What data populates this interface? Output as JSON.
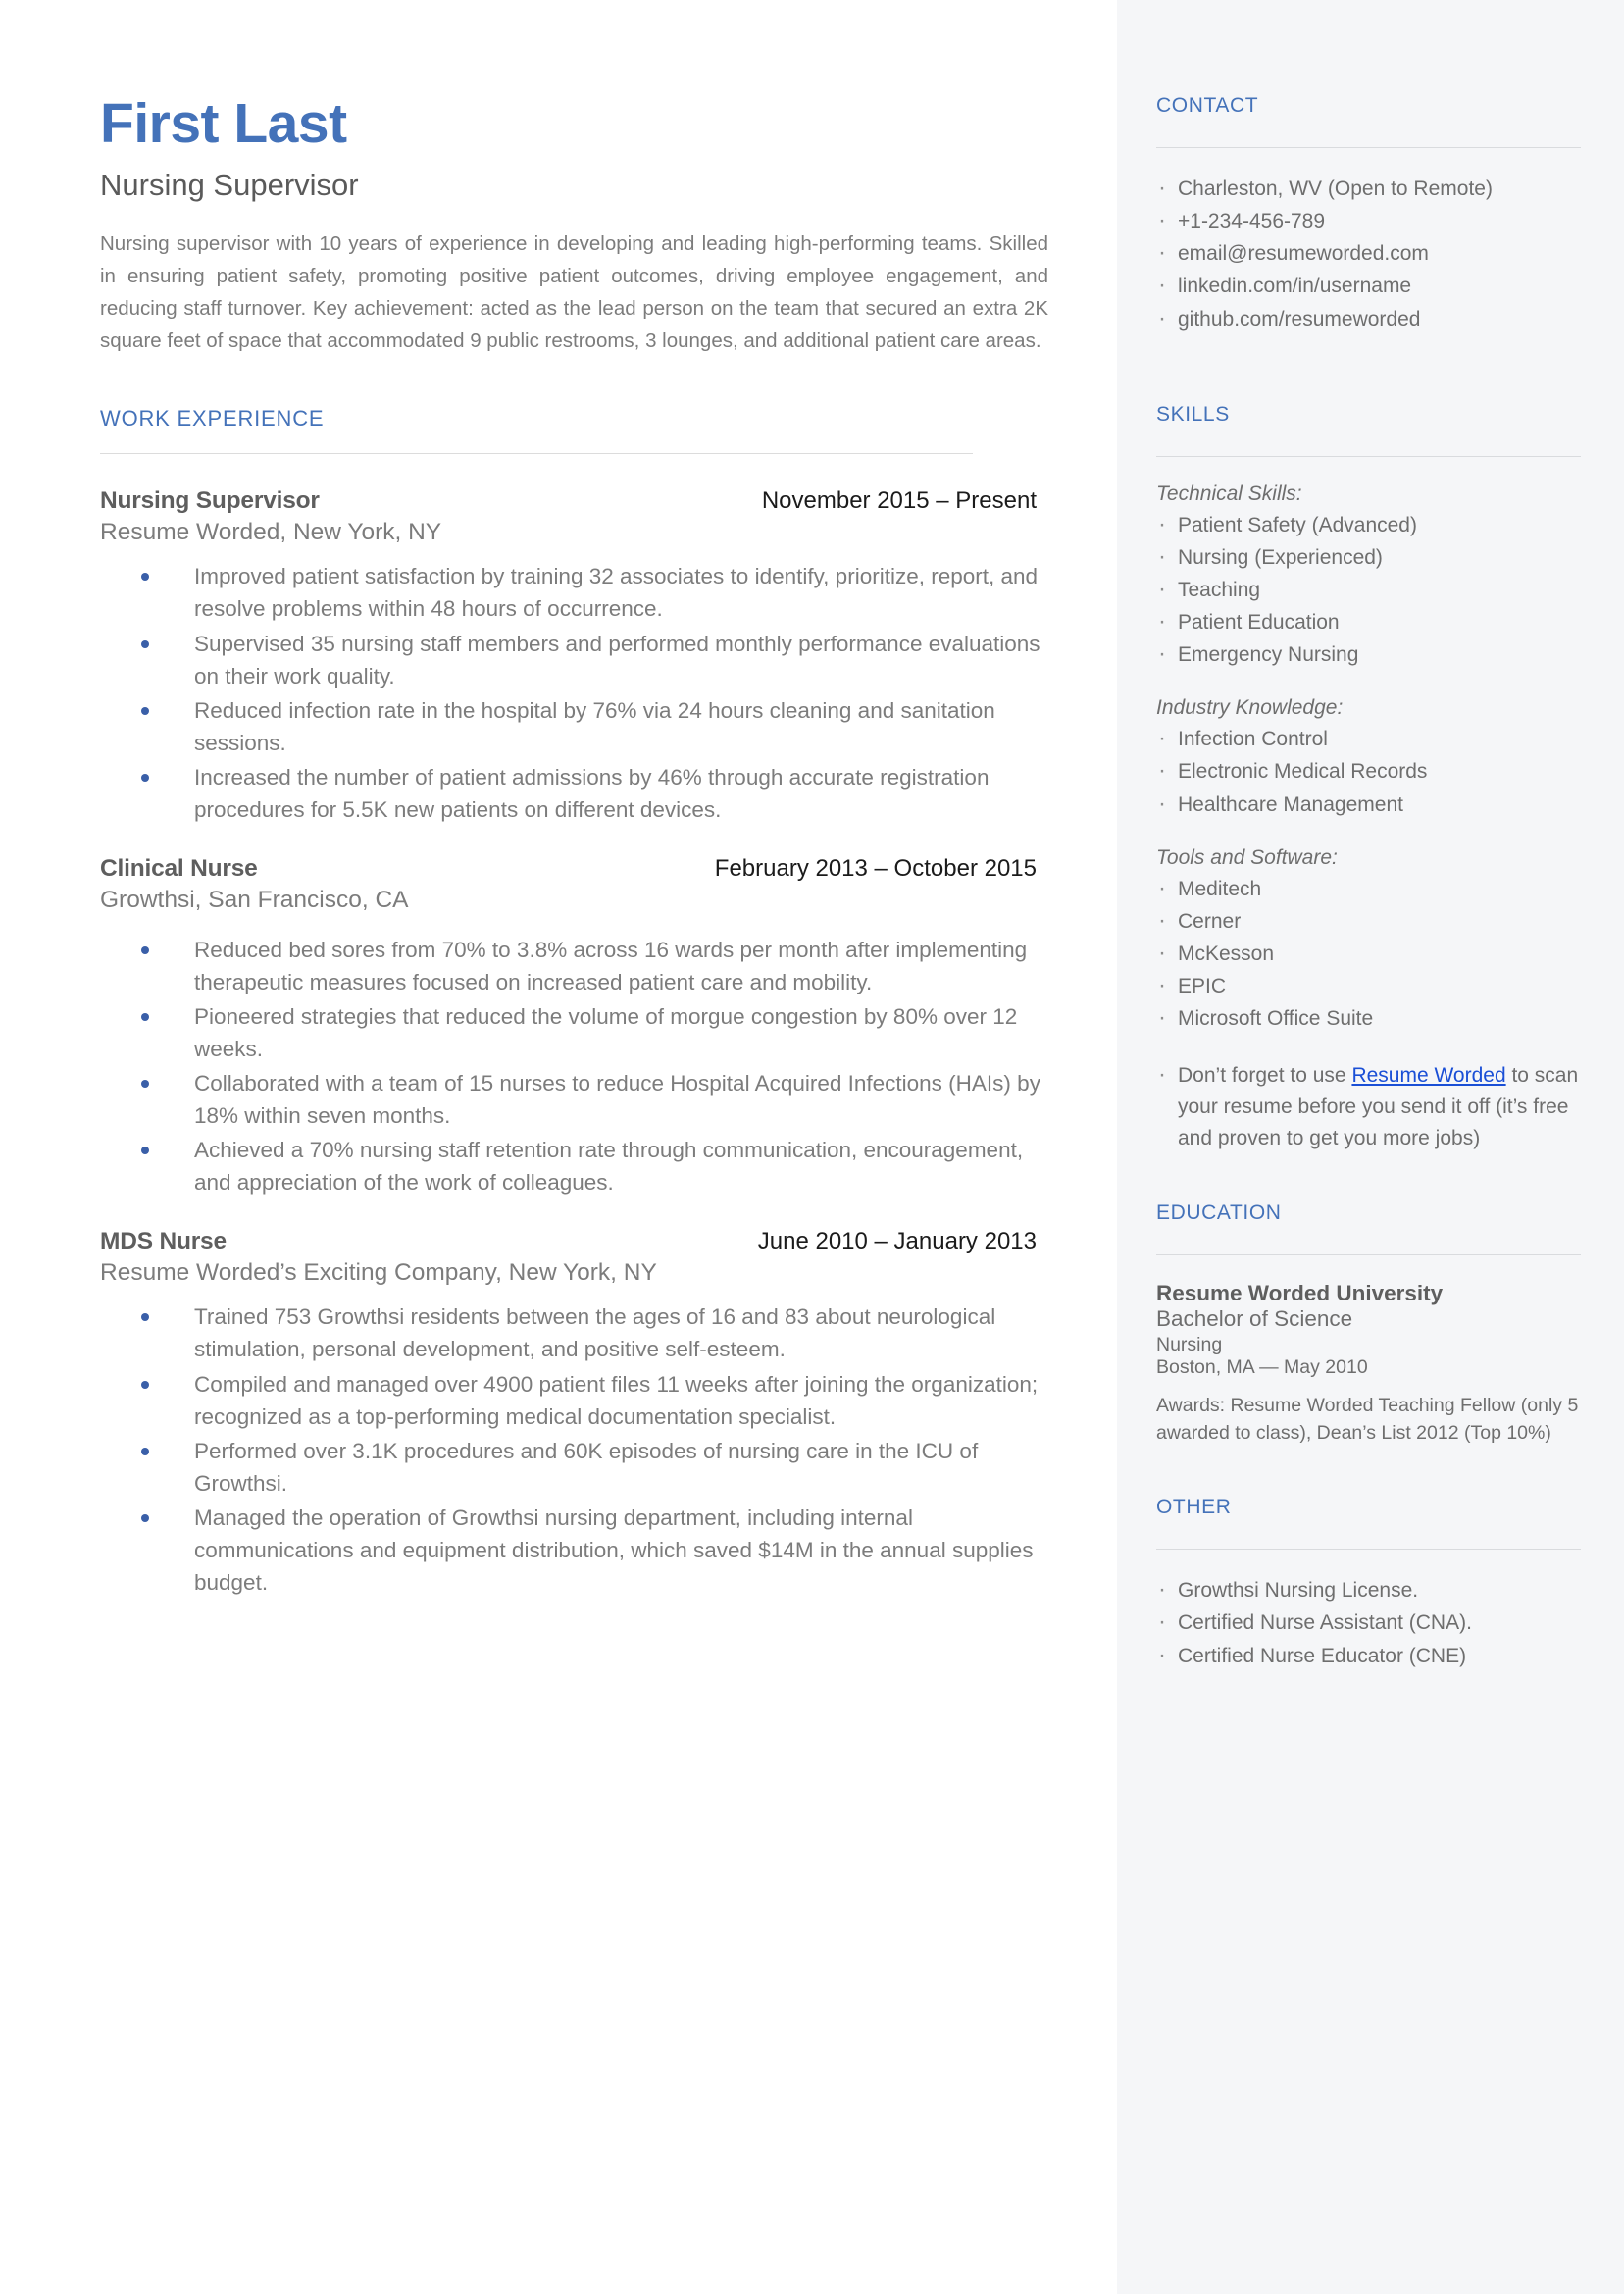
{
  "header": {
    "name": "First Last",
    "job_title": "Nursing Supervisor",
    "summary": "Nursing supervisor with 10 years of experience in developing and leading high-performing teams. Skilled in ensuring patient safety, promoting positive patient outcomes, driving employee engagement, and reducing staff turnover. Key achievement: acted as the lead person on the team that secured an extra 2K square feet of space that accommodated 9 public restrooms, 3 lounges, and additional patient care areas."
  },
  "work_experience": {
    "section_label": "WORK EXPERIENCE",
    "jobs": [
      {
        "role": "Nursing Supervisor",
        "dates": "November 2015 – Present",
        "company": "Resume Worded, New York, NY",
        "bullets": [
          "Improved patient satisfaction by training 32 associates to identify, prioritize, report, and resolve problems within 48 hours of occurrence.",
          "Supervised 35 nursing staff members and performed monthly performance evaluations on their work quality.",
          "Reduced infection rate in the hospital by 76% via 24 hours cleaning and sanitation sessions.",
          "Increased the number of patient admissions by 46% through accurate registration procedures for 5.5K new patients on different devices."
        ]
      },
      {
        "role": "Clinical Nurse",
        "dates": "February 2013 – October 2015",
        "company": "Growthsi, San Francisco, CA",
        "bullets": [
          "Reduced bed sores from 70% to 3.8% across 16 wards per month after implementing therapeutic measures focused on increased patient care and mobility.",
          "Pioneered strategies that reduced the volume of morgue congestion by 80% over 12 weeks.",
          "Collaborated with a team of 15 nurses to reduce Hospital Acquired Infections (HAIs) by 18% within seven months.",
          "Achieved a 70% nursing staff retention rate through communication, encouragement, and appreciation of the work of colleagues."
        ]
      },
      {
        "role": "MDS Nurse",
        "dates": "June 2010 – January 2013",
        "company": "Resume Worded’s Exciting Company, New York, NY",
        "bullets": [
          "Trained 753 Growthsi residents between the ages of 16 and 83 about neurological stimulation, personal development, and positive self-esteem.",
          "Compiled and managed over 4900 patient files 11 weeks after joining the organization; recognized as a top-performing medical documentation specialist.",
          "Performed over 3.1K procedures and 60K episodes of nursing care in the ICU of Growthsi.",
          "Managed the operation of Growthsi nursing department, including internal communications and equipment distribution, which saved $14M in the annual supplies budget."
        ]
      }
    ]
  },
  "sidebar": {
    "contact": {
      "label": "CONTACT",
      "items": [
        "Charleston, WV (Open to Remote)",
        "+1-234-456-789",
        "email@resumeworded.com",
        "linkedin.com/in/username",
        "github.com/resumeworded"
      ]
    },
    "skills": {
      "label": "SKILLS",
      "groups": [
        {
          "title": "Technical Skills:",
          "items": [
            "Patient Safety (Advanced)",
            "Nursing (Experienced)",
            "Teaching",
            "Patient Education",
            "Emergency Nursing"
          ]
        },
        {
          "title": "Industry Knowledge:",
          "items": [
            "Infection Control",
            "Electronic Medical Records",
            "Healthcare Management"
          ]
        },
        {
          "title": "Tools and Software:",
          "items": [
            "Meditech",
            "Cerner",
            "McKesson",
            "EPIC",
            "Microsoft Office Suite"
          ]
        }
      ],
      "promo": {
        "before_link": "Don’t forget to use ",
        "link_text": "Resume Worded",
        "after_link": " to scan your resume before you send it off (it’s free and proven to get you more jobs)"
      }
    },
    "education": {
      "label": "EDUCATION",
      "school": "Resume Worded University",
      "degree": "Bachelor of Science",
      "field": "Nursing",
      "location_date": "Boston, MA — May 2010",
      "awards": "Awards: Resume Worded Teaching Fellow (only 5 awarded to class), Dean’s List 2012 (Top 10%)"
    },
    "other": {
      "label": "OTHER",
      "items": [
        "Growthsi Nursing License.",
        "Certified Nurse Assistant (CNA).",
        "Certified Nurse Educator (CNE)"
      ]
    }
  },
  "colors": {
    "accent_blue": "#4472b9",
    "link_blue": "#1a4fd6",
    "bullet_blue": "#3a5fa8",
    "sidebar_bg": "#f5f6f8",
    "body_text": "#7c7c7c"
  }
}
